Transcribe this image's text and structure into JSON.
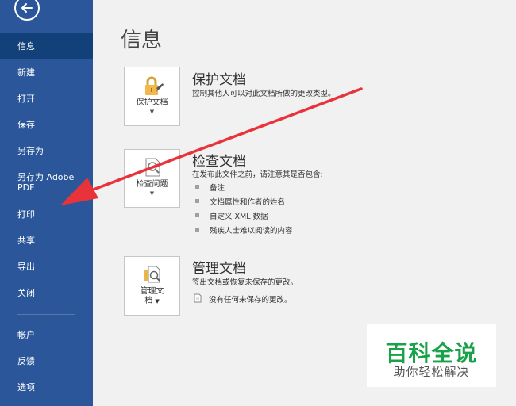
{
  "sidebar": {
    "items": [
      {
        "label": "信息",
        "active": true
      },
      {
        "label": "新建"
      },
      {
        "label": "打开"
      },
      {
        "label": "保存"
      },
      {
        "label": "另存为"
      },
      {
        "label": "另存为 Adobe PDF"
      },
      {
        "label": "打印"
      },
      {
        "label": "共享"
      },
      {
        "label": "导出"
      },
      {
        "label": "关闭"
      },
      {
        "label": "帐户"
      },
      {
        "label": "反馈"
      },
      {
        "label": "选项"
      }
    ]
  },
  "main": {
    "title": "信息",
    "sections": [
      {
        "tile_label": "保护文档",
        "title": "保护文档",
        "desc": "控制其他人可以对此文档所做的更改类型。"
      },
      {
        "tile_label": "检查问题",
        "title": "检查文档",
        "desc": "在发布此文件之前，请注意其是否包含:",
        "bullets": [
          "备注",
          "文档属性和作者的姓名",
          "自定义 XML 数据",
          "残疾人士难以阅读的内容"
        ]
      },
      {
        "tile_label_line1": "管理文",
        "tile_label_line2": "档",
        "title": "管理文档",
        "desc": "签出文档或恢复未保存的更改。",
        "note": "没有任何未保存的更改。"
      }
    ]
  },
  "watermark": {
    "title": "百科全说",
    "subtitle": "助你轻松解决"
  },
  "colors": {
    "sidebar": "#2b579a",
    "sidebar_active": "#124078",
    "arrow": "#e8333a",
    "watermark_green": "#1aa24a"
  }
}
